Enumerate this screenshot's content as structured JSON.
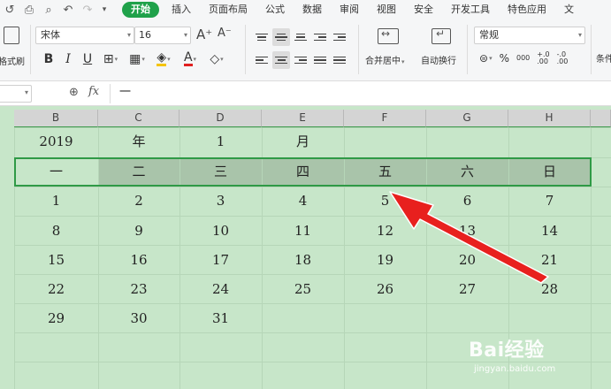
{
  "menubar": {
    "items": [
      "开始",
      "插入",
      "页面布局",
      "公式",
      "数据",
      "审阅",
      "视图",
      "安全",
      "开发工具",
      "特色应用",
      "文"
    ],
    "active_index": 0,
    "accent_color": "#1fa14a"
  },
  "ribbon": {
    "format_painter_label": "格式刷",
    "font_name": "宋体",
    "font_size": "16",
    "grow_label": "A⁺",
    "shrink_label": "A⁻",
    "bold": "B",
    "italic": "I",
    "underline": "U",
    "font_color_glyph": "A",
    "merge_label": "合并居中",
    "wrap_label": "自动换行",
    "number_format": "常规",
    "percent": "%",
    "thousands": "000",
    "inc_decimal": "+.0\n.00",
    "dec_decimal": "-.0\n.00",
    "cond_label": "条件"
  },
  "formula_bar": {
    "fx_label": "fx",
    "content": "一"
  },
  "sheet": {
    "columns": [
      "B",
      "C",
      "D",
      "E",
      "F",
      "G",
      "H"
    ],
    "rows": [
      [
        "2019",
        "年",
        "1",
        "月",
        "",
        "",
        ""
      ],
      [
        "一",
        "二",
        "三",
        "四",
        "五",
        "六",
        "日"
      ],
      [
        "1",
        "2",
        "3",
        "4",
        "5",
        "6",
        "7"
      ],
      [
        "8",
        "9",
        "10",
        "11",
        "12",
        "13",
        "14"
      ],
      [
        "15",
        "16",
        "17",
        "18",
        "19",
        "20",
        "21"
      ],
      [
        "22",
        "23",
        "24",
        "25",
        "26",
        "27",
        "28"
      ],
      [
        "29",
        "30",
        "31",
        "",
        "",
        "",
        ""
      ]
    ],
    "sheet_color": "#c7e6c9",
    "selection_color": "#2f9a46",
    "annotation_arrow_color": "#e8201e"
  },
  "watermark": {
    "logo": "Bai经验",
    "url": "jingyan.baidu.com"
  }
}
